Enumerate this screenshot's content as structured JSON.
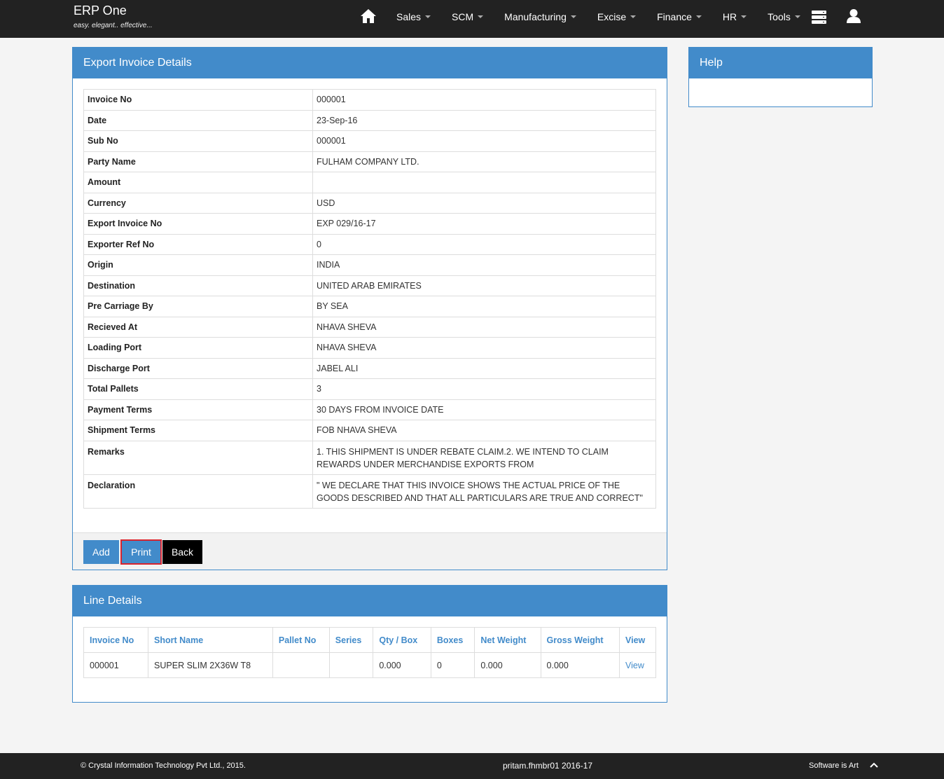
{
  "app": {
    "title": "ERP One",
    "tagline": "easy. elegant.. effective..."
  },
  "nav": {
    "items": [
      {
        "label": "Sales"
      },
      {
        "label": "SCM"
      },
      {
        "label": "Manufacturing"
      },
      {
        "label": "Excise"
      },
      {
        "label": "Finance"
      },
      {
        "label": "HR"
      },
      {
        "label": "Tools"
      }
    ],
    "icons": [
      "home-icon",
      "server-stack-icon",
      "user-icon"
    ]
  },
  "details": {
    "heading": "Export Invoice Details",
    "rows": [
      {
        "label": "Invoice No",
        "value": "000001"
      },
      {
        "label": "Date",
        "value": "23-Sep-16"
      },
      {
        "label": "Sub No",
        "value": "000001"
      },
      {
        "label": "Party Name",
        "value": "FULHAM COMPANY LTD."
      },
      {
        "label": "Amount",
        "value": ""
      },
      {
        "label": "Currency",
        "value": "USD"
      },
      {
        "label": "Export Invoice No",
        "value": "EXP 029/16-17"
      },
      {
        "label": "Exporter Ref No",
        "value": "0"
      },
      {
        "label": "Origin",
        "value": "INDIA"
      },
      {
        "label": "Destination",
        "value": "UNITED ARAB EMIRATES"
      },
      {
        "label": "Pre Carriage By",
        "value": "BY SEA"
      },
      {
        "label": "Recieved At",
        "value": "NHAVA SHEVA"
      },
      {
        "label": "Loading Port",
        "value": "NHAVA SHEVA"
      },
      {
        "label": "Discharge Port",
        "value": "JABEL ALI"
      },
      {
        "label": "Total Pallets",
        "value": "3"
      },
      {
        "label": "Payment Terms",
        "value": "30 DAYS FROM INVOICE DATE"
      },
      {
        "label": "Shipment Terms",
        "value": "FOB NHAVA SHEVA"
      },
      {
        "label": "Remarks",
        "value": "1. THIS SHIPMENT IS UNDER REBATE CLAIM.2. WE INTEND TO CLAIM REWARDS UNDER MERCHANDISE EXPORTS FROM"
      },
      {
        "label": "Declaration",
        "value": "\" WE DECLARE THAT THIS INVOICE SHOWS THE ACTUAL PRICE OF THE GOODS DESCRIBED AND THAT ALL PARTICULARS ARE TRUE AND CORRECT\""
      }
    ],
    "buttons": {
      "add": "Add",
      "print": "Print",
      "back": "Back"
    }
  },
  "help": {
    "heading": "Help"
  },
  "line_details": {
    "heading": "Line Details",
    "columns": [
      "Invoice No",
      "Short Name",
      "Pallet No",
      "Series",
      "Qty / Box",
      "Boxes",
      "Net Weight",
      "Gross Weight",
      "View"
    ],
    "rows": [
      [
        "000001",
        "SUPER SLIM 2X36W T8",
        "",
        "",
        "0.000",
        "0",
        "0.000",
        "0.000",
        "View"
      ]
    ]
  },
  "footer": {
    "copyright": "© Crystal Information Technology Pvt Ltd., 2015.",
    "session": "pritam.fhmbr01 2016-17",
    "slogan": "Software is Art"
  },
  "colors": {
    "navbar": "#222222",
    "accent": "#428bca",
    "print_outline": "#d9232d"
  }
}
